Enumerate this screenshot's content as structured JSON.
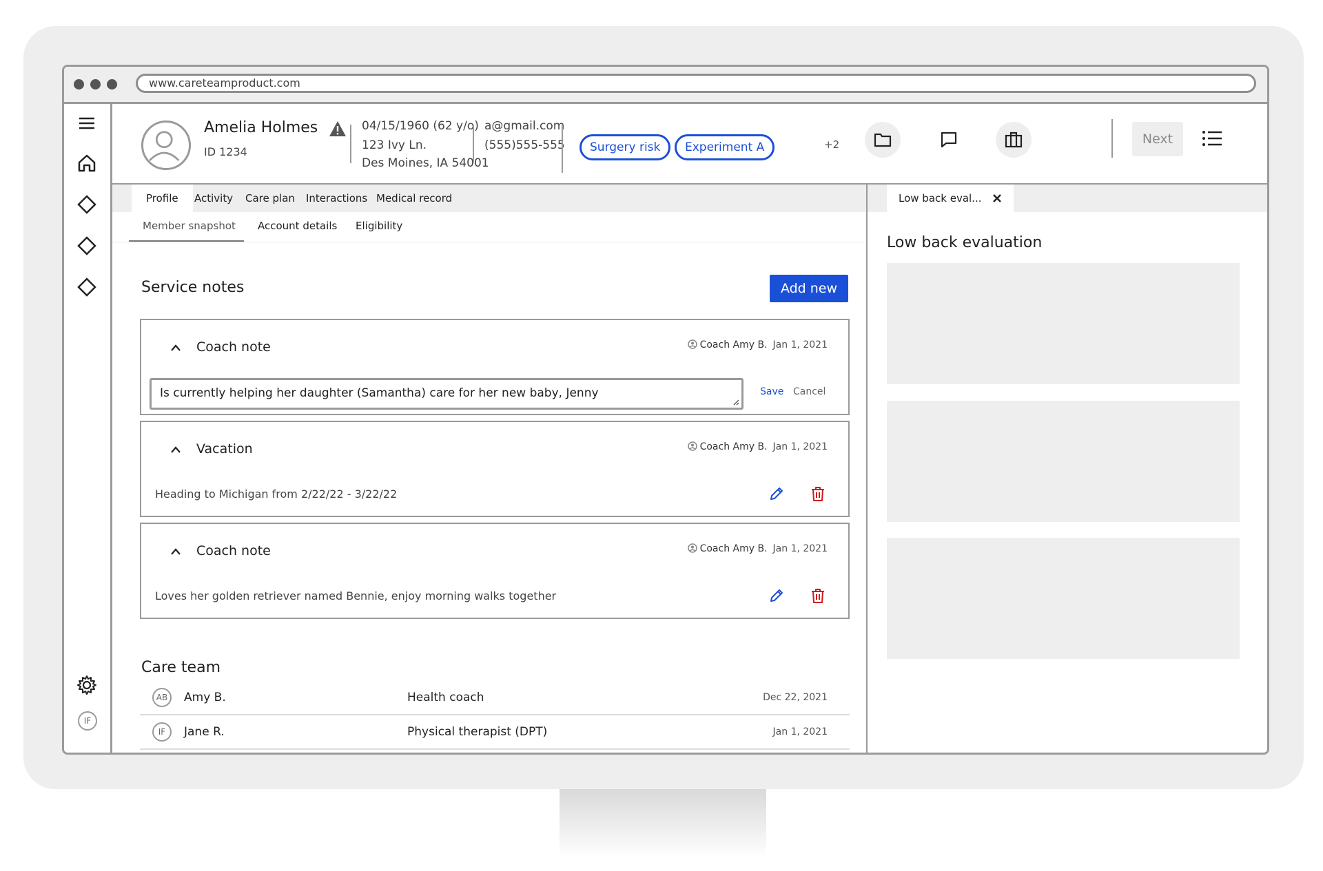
{
  "browser": {
    "url": "www.careteamproduct.com"
  },
  "nav": {
    "user_initials": "IF",
    "icons": [
      "menu-icon",
      "home-icon",
      "diamond-icon",
      "diamond-icon",
      "diamond-icon",
      "gear-icon"
    ]
  },
  "member": {
    "name": "Amelia Holmes",
    "id": "ID 1234",
    "dob": "04/15/1960  (62 y/o)",
    "address_line1": "123 Ivy Ln.",
    "address_line2": "Des Moines, IA  54001",
    "email": "a@gmail.com",
    "phone": "(555)555-555",
    "tags": [
      "Surgery risk",
      "Experiment A"
    ],
    "more_tags": "+2"
  },
  "header_actions": {
    "next_label": "Next"
  },
  "tabs": [
    "Profile",
    "Activity",
    "Care plan",
    "Interactions",
    "Medical record"
  ],
  "subtabs": [
    "Member snapshot",
    "Account details",
    "Eligibility"
  ],
  "service_notes": {
    "title": "Service notes",
    "add_label": "Add new",
    "save_label": "Save",
    "cancel_label": "Cancel",
    "notes": [
      {
        "title": "Coach note",
        "author": "Coach Amy B.",
        "date": "Jan 1, 2021",
        "body": "Is currently helping her daughter (Samantha) care for her new baby, Jenny"
      },
      {
        "title": "Vacation",
        "author": "Coach Amy B.",
        "date": "Jan 1, 2021",
        "body": "Heading to Michigan from 2/22/22 - 3/22/22"
      },
      {
        "title": "Coach note",
        "author": "Coach Amy B.",
        "date": "Jan 1, 2021",
        "body": "Loves her golden retriever named Bennie, enjoy morning walks together"
      }
    ]
  },
  "care_team": {
    "title": "Care team",
    "members": [
      {
        "initials": "AB",
        "name": "Amy B.",
        "role": "Health coach",
        "date": "Dec 22, 2021"
      },
      {
        "initials": "IF",
        "name": "Jane R.",
        "role": "Physical therapist (DPT)",
        "date": "Jan 1, 2021"
      }
    ]
  },
  "right_panel": {
    "tab_label": "Low back eval...",
    "title": "Low back evaluation"
  },
  "colors": {
    "accent": "#1a4fd8",
    "danger": "#d11a1a",
    "border": "#9a9a9a",
    "surface": "#eeeeee"
  }
}
